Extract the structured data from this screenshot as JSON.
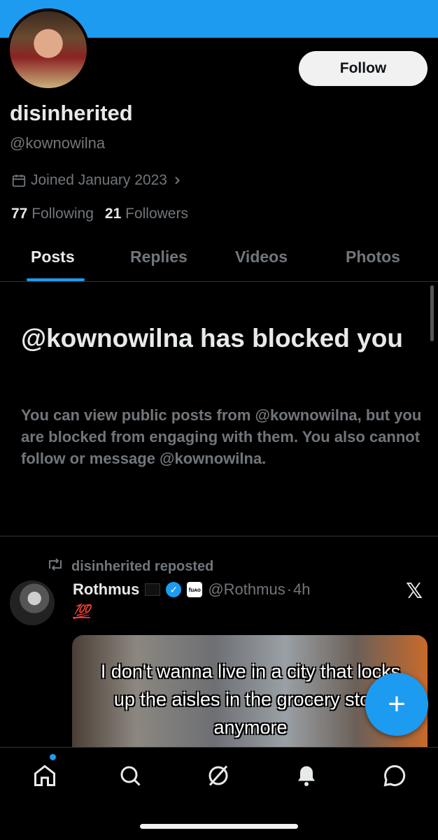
{
  "profile": {
    "display_name": "disinherited",
    "handle": "@kownowilna",
    "joined": "Joined January 2023",
    "following_count": "77",
    "following_label": "Following",
    "followers_count": "21",
    "followers_label": "Followers",
    "follow_label": "Follow"
  },
  "tabs": [
    {
      "label": "Posts",
      "active": true
    },
    {
      "label": "Replies",
      "active": false
    },
    {
      "label": "Videos",
      "active": false
    },
    {
      "label": "Photos",
      "active": false
    }
  ],
  "blocked": {
    "title": "@kownowilna has blocked you",
    "body": "You can view public posts from @kownowilna, but you are blocked from engaging with them. You also cannot follow or message @kownowilna."
  },
  "post": {
    "repost_text": "disinherited reposted",
    "author": "Rothmus",
    "badge_text": "fuᴀo",
    "handle": "@Rothmus",
    "separator": "·",
    "time": "4h",
    "text": "💯",
    "media_caption": "I don't wanna live in a city that locks up the aisles in the grocery store anymore"
  },
  "icons": {
    "calendar": "calendar-icon",
    "chevron": "chevron-right-icon",
    "repost": "repost-icon",
    "verified": "verified-badge-icon",
    "x_logo": "x-logo-icon",
    "fab": "compose-plus-icon",
    "nav": [
      "home-icon",
      "search-icon",
      "grok-icon",
      "notifications-icon",
      "messages-icon"
    ]
  },
  "colors": {
    "accent": "#1d9bf0",
    "background": "#000000",
    "muted_text": "#71767b",
    "primary_text": "#e7e9ea"
  }
}
